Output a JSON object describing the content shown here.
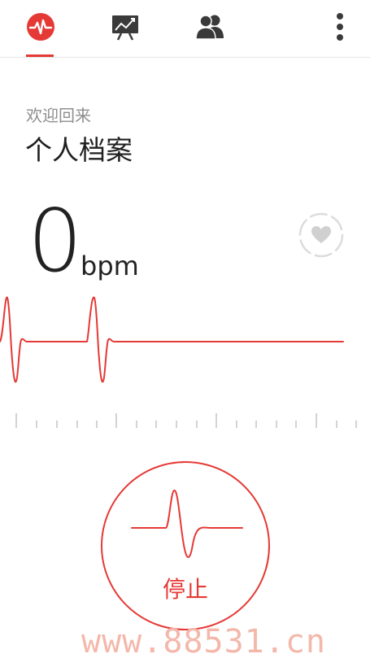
{
  "tabs": [
    {
      "icon": "heart-rate-icon",
      "active": true
    },
    {
      "icon": "chart-board-icon",
      "active": false
    },
    {
      "icon": "people-icon",
      "active": false
    }
  ],
  "menu_icon": "more-vert-icon",
  "welcome_text": "欢迎回来",
  "profile_title": "个人档案",
  "bpm": {
    "value": "0",
    "unit": "bpm"
  },
  "favorite_icon": "heart-icon",
  "stop_button": {
    "label": "停止",
    "icon": "pulse-wave-icon"
  },
  "watermark": "www.88531.cn",
  "colors": {
    "accent": "#e53935",
    "icon_gray": "#3a3a3a",
    "divider": "#e6e6e6"
  }
}
